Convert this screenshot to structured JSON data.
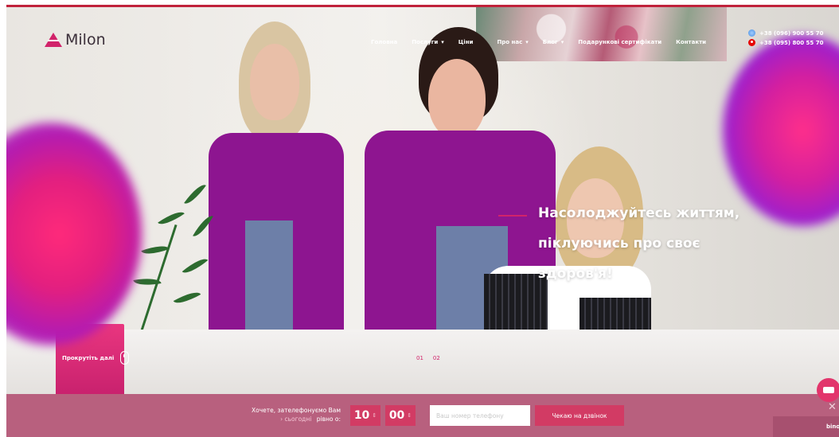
{
  "brand": {
    "name": "Milon",
    "accent": "#d1236a"
  },
  "nav": {
    "items": [
      {
        "label": "Головна",
        "dropdown": false
      },
      {
        "label": "Послуги",
        "dropdown": true
      },
      {
        "label": "Ціни",
        "dropdown": false
      },
      {
        "label": "Про нас",
        "dropdown": true
      },
      {
        "label": "Блог",
        "dropdown": true
      },
      {
        "label": "Подарункові сертифікати",
        "dropdown": false
      },
      {
        "label": "Контакти",
        "dropdown": false
      }
    ]
  },
  "phones": [
    {
      "number": "+38 (096) 900 55 70",
      "icon": "kyivstar-icon"
    },
    {
      "number": "+38 (095) 800 55 70",
      "icon": "vodafone-icon"
    }
  ],
  "hero": {
    "tagline": [
      "Насолоджуйтесь життям,",
      "піклуючись про своє",
      "здоров'я!"
    ],
    "scroll_label": "Прокрутіть далі",
    "pages": [
      "01",
      "02"
    ]
  },
  "callback": {
    "prompt": "Хочете, зателефонуємо Вам",
    "day": "сьогодні",
    "at_label": "рівно о:",
    "hour": "10",
    "minute": "00",
    "phone_placeholder": "Ваш номер телефону",
    "submit_label": "Чекаю на дзвінок",
    "bar_color": "#b8607e"
  },
  "corner_text": "binota"
}
